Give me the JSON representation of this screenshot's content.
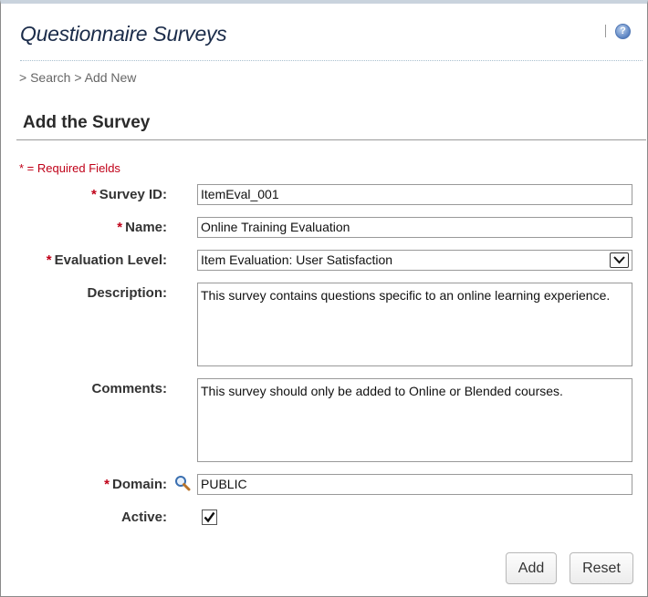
{
  "header": {
    "title": "Questionnaire Surveys",
    "help_icon": "question-icon"
  },
  "breadcrumb": "> Search > Add New",
  "section": {
    "title": "Add the Survey",
    "required_note": "* = Required Fields"
  },
  "form": {
    "survey_id": {
      "label": "Survey ID:",
      "value": "ItemEval_001",
      "required": true
    },
    "name": {
      "label": "Name:",
      "value": "Online Training Evaluation",
      "required": true
    },
    "evaluation_level": {
      "label": "Evaluation Level:",
      "value": "Item Evaluation: User Satisfaction",
      "required": true
    },
    "description": {
      "label": "Description:",
      "value": "This survey contains questions specific to an online learning experience."
    },
    "comments": {
      "label": "Comments:",
      "value": "This survey should only be added to Online or Blended courses."
    },
    "domain": {
      "label": "Domain:",
      "value": "PUBLIC",
      "required": true,
      "icon": "search-icon"
    },
    "active": {
      "label": "Active:",
      "checked": true
    }
  },
  "buttons": {
    "add": "Add",
    "reset": "Reset"
  },
  "colors": {
    "required": "#c00018",
    "title": "#1b2c4a"
  }
}
